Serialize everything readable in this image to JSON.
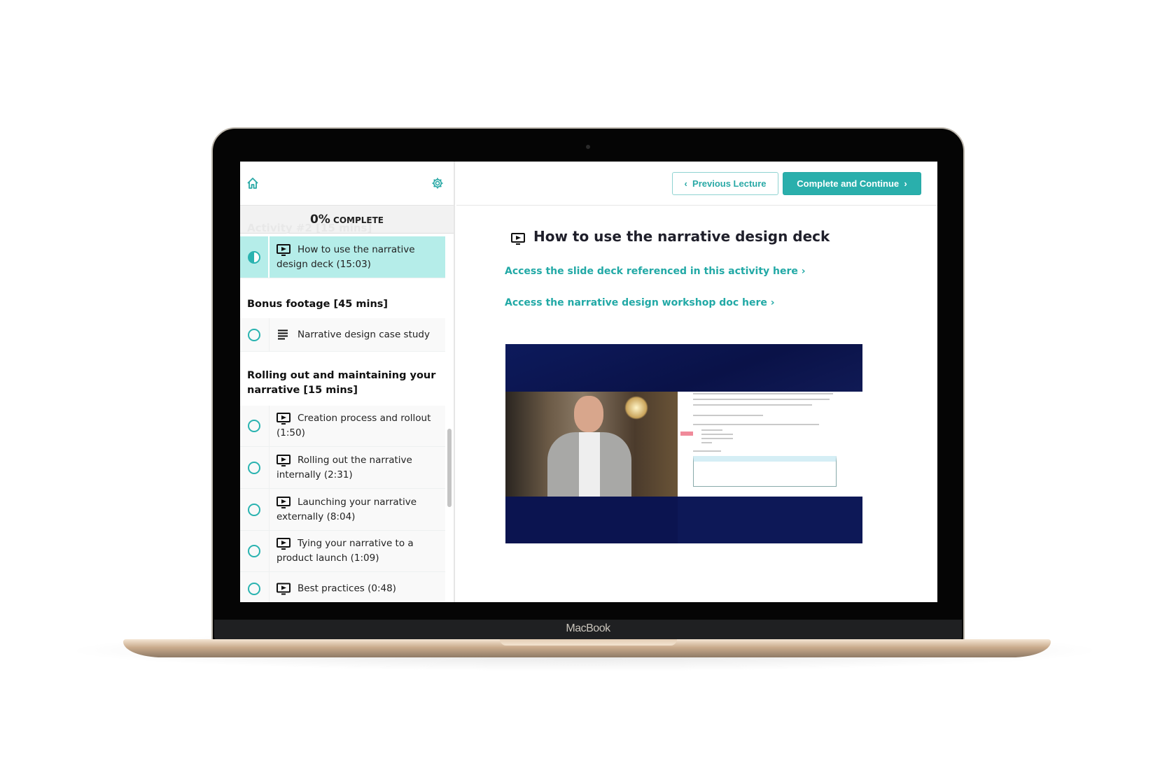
{
  "device": {
    "brand": "MacBook"
  },
  "sidebar": {
    "home_icon": "home-icon",
    "settings_icon": "gear-icon",
    "progress": {
      "percent_label": "0%",
      "label": "COMPLETE",
      "value": 0
    },
    "ghost_heading": "Activity #2 [15 mins]",
    "active_item": {
      "title": "How to use the narrative design deck (15:03)",
      "type": "video",
      "status": "in-progress"
    },
    "sections": [
      {
        "title": "Bonus footage [45 mins]",
        "items": [
          {
            "title": "Narrative design case study",
            "type": "text",
            "status": "incomplete"
          }
        ]
      },
      {
        "title": "Rolling out and maintaining your narrative [15 mins]",
        "items": [
          {
            "title": "Creation process and rollout (1:50)",
            "type": "video",
            "status": "incomplete"
          },
          {
            "title": "Rolling out the narrative internally (2:31)",
            "type": "video",
            "status": "incomplete"
          },
          {
            "title": "Launching your narrative externally (8:04)",
            "type": "video",
            "status": "incomplete"
          },
          {
            "title": "Tying your narrative to a product launch (1:09)",
            "type": "video",
            "status": "incomplete"
          },
          {
            "title": "Best practices (0:48)",
            "type": "video",
            "status": "incomplete"
          }
        ]
      }
    ]
  },
  "header": {
    "prev_label": "Previous Lecture",
    "next_label": "Complete and Continue"
  },
  "lecture": {
    "title": "How to use the narrative design deck",
    "links": [
      "Access the slide deck referenced in this activity here ›",
      "Access the narrative design workshop doc here ›"
    ]
  },
  "colors": {
    "accent": "#2aafac",
    "active_bg": "#b5ede9",
    "video_bg": "#0b1450"
  }
}
